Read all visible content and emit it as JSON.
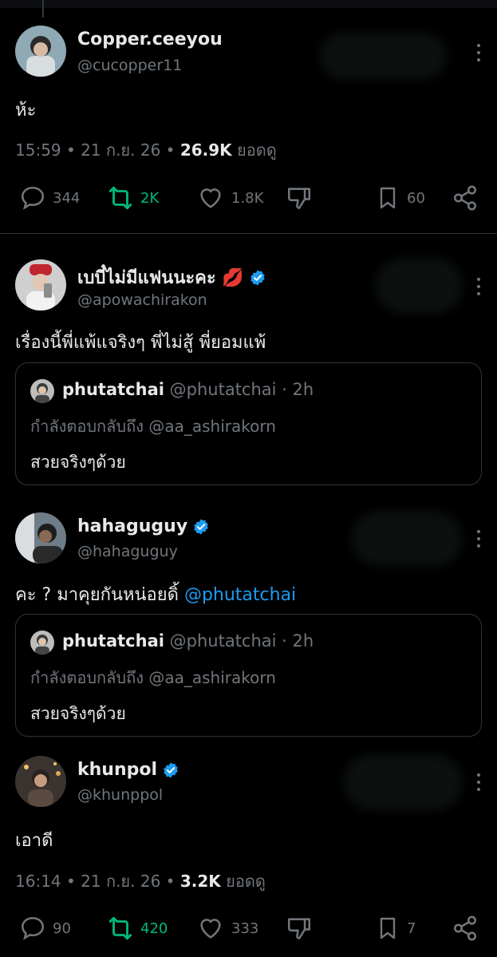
{
  "post1": {
    "name": "Copper.ceeyou",
    "handle": "@cucopper11",
    "text": "ห้ะ",
    "time": "15:59 • 21 ก.ย. 26 •",
    "views_count": "26.9K",
    "views_label": "ยอดดู",
    "replies": "344",
    "reposts": "2K",
    "likes": "1.8K",
    "bookmarks": "60"
  },
  "post2": {
    "name": "เบบี๋ไม่มีแฟนนะคะ 💋",
    "handle": "@apowachirakon",
    "text": "เรื่องนี้พี่แพ้แจริงๆ พี่ไม่สู้  พี่ยอมแพ้",
    "quote": {
      "name": "phutatchai",
      "handle": "@phutatchai · 2h",
      "reply_to": "กำลังตอบกลับถึง @aa_ashirakorn",
      "text": "สวยจริงๆด้วย"
    }
  },
  "post3": {
    "name": "hahaguguy",
    "handle": "@hahaguguy",
    "text": "คะ ? มาคุยกันหน่อยดิ้ ",
    "mention": "@phutatchai",
    "quote": {
      "name": "phutatchai",
      "handle": "@phutatchai · 2h",
      "reply_to": "กำลังตอบกลับถึง @aa_ashirakorn",
      "text": "สวยจริงๆด้วย"
    }
  },
  "post4": {
    "name": "khunpol",
    "handle": "@khunppol",
    "text": "เอาดี",
    "time": "16:14 • 21 ก.ย. 26 •",
    "views_count": "3.2K",
    "views_label": "ยอดดู",
    "replies": "90",
    "reposts": "420",
    "likes": "333",
    "bookmarks": "7"
  },
  "colors": {
    "background": "#000000",
    "text": "#e7e9ea",
    "muted": "#71767b",
    "accent": "#1d9bf0",
    "repost_active": "#00ba7c",
    "verified": "#1d9bf0"
  },
  "icons": [
    "reply-icon",
    "repost-icon",
    "like-icon",
    "dislike-icon",
    "bookmark-icon",
    "share-icon",
    "more-icon",
    "verified-icon"
  ]
}
